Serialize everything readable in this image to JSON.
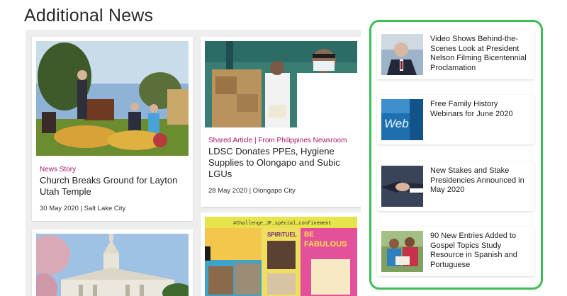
{
  "section": {
    "title": "Additional News"
  },
  "cards": [
    {
      "category": "News Story",
      "headline": "Church Breaks Ground for Layton Utah Temple",
      "meta": "30 May 2020 | Salt Lake City"
    },
    {
      "category": "Shared Article | From Philippines Newsroom",
      "headline": "LDSC Donates PPEs, Hygiene Supplies to Olongapo and Subic LGUs",
      "meta": "28 May 2020 | Olongapo City"
    },
    {
      "image_text": ""
    },
    {
      "image_text": {
        "hashtag": "#Challenge_JF_spécial_confinement",
        "spirituel": "SPIRITUEL",
        "be": "BE",
        "fabulous": "FABULOUS"
      }
    }
  ],
  "sidebar": {
    "border_color": "#3cbd56",
    "items": [
      {
        "title": "Video Shows Behind-the-Scenes Look at President Nelson Filming Bicentennial Proclamation"
      },
      {
        "title": "Free Family History Webinars for June 2020",
        "image_text": "Web"
      },
      {
        "title": "New Stakes and Stake Presidencies Announced in May 2020"
      },
      {
        "title": "90 New Entries Added to Gospel Topics Study Resource in Spanish and Portuguese"
      }
    ]
  },
  "colors": {
    "accent": "#a6186d",
    "panel_bg": "#eeeeee"
  }
}
